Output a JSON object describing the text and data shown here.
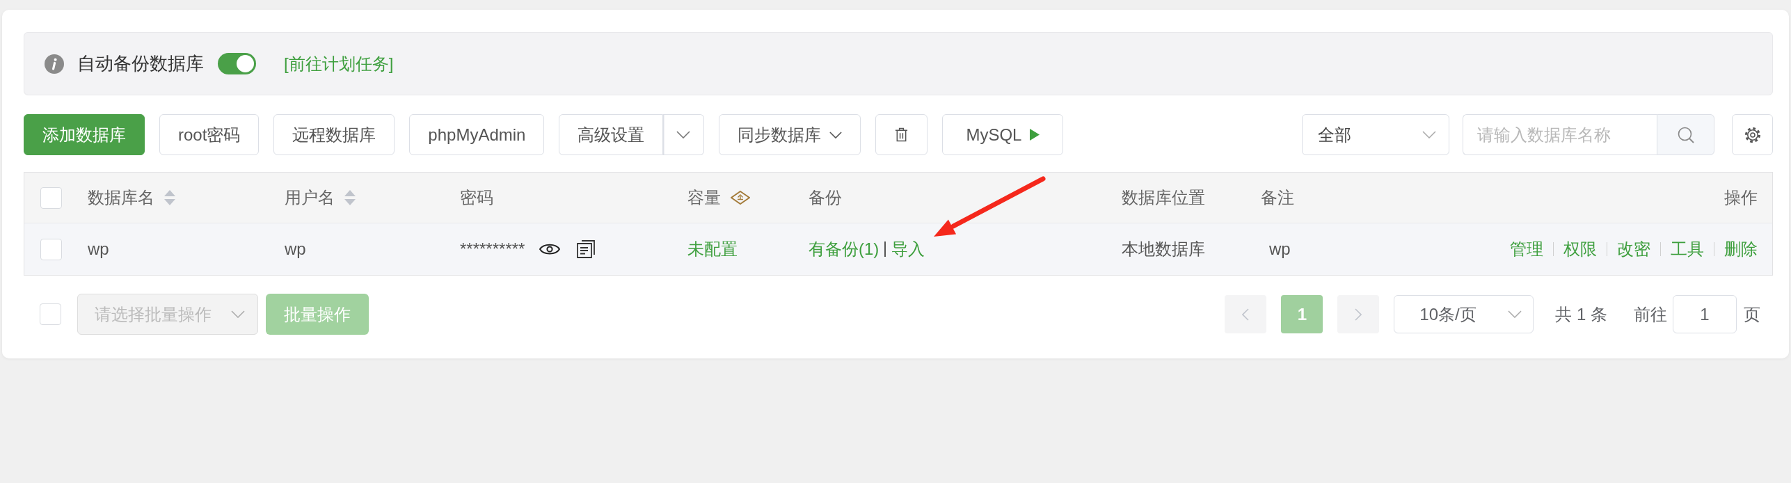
{
  "info_bar": {
    "label": "自动备份数据库",
    "toggle": {
      "on": true
    },
    "link": "[前往计划任务]"
  },
  "toolbar": {
    "buttons": [
      {
        "kind": "primary",
        "label": "添加数据库"
      },
      {
        "kind": "plain",
        "label": "root密码"
      },
      {
        "kind": "plain",
        "label": "远程数据库"
      },
      {
        "kind": "plain",
        "label": "phpMyAdmin"
      },
      {
        "kind": "split",
        "label": "高级设置"
      },
      {
        "kind": "dropdown",
        "label": "同步数据库"
      },
      {
        "kind": "trash"
      },
      {
        "kind": "run",
        "label": "MySQL"
      }
    ],
    "filter": {
      "value": "全部"
    },
    "search": {
      "placeholder": "请输入数据库名称"
    }
  },
  "table": {
    "select_all": {
      "checked": false
    },
    "columns": [
      {
        "label": "数据库名",
        "kind": "sortable"
      },
      {
        "label": "用户名",
        "kind": "sortable"
      },
      {
        "label": "密码",
        "kind": "plain"
      },
      {
        "label": "容量",
        "kind": "premium"
      },
      {
        "label": "备份",
        "kind": "plain"
      },
      {
        "label": "数据库位置",
        "kind": "plain"
      },
      {
        "label": "备注",
        "kind": "plain"
      },
      {
        "label": "操作",
        "kind": "plain"
      }
    ],
    "rows": [
      {
        "checked": false,
        "name": "wp",
        "user": "wp",
        "password": "**********",
        "capacity": "未配置",
        "backup": "有备份(1)",
        "backup_action": "导入",
        "location": "本地数据库",
        "note": "wp",
        "actions": [
          "管理",
          "权限",
          "改密",
          "工具",
          "删除"
        ]
      }
    ]
  },
  "footer": {
    "select_all": {
      "checked": false
    },
    "batch_select": {
      "placeholder": "请选择批量操作",
      "disabled": true
    },
    "batch_button": {
      "label": "批量操作",
      "disabled": true
    },
    "pagination": {
      "prev": {
        "disabled": true
      },
      "pages": [
        {
          "label": "1",
          "selected": true
        }
      ],
      "next": {
        "disabled": true
      },
      "page_size": "10条/页",
      "total": "共 1 条",
      "goto_label": "前往",
      "goto_value": "1",
      "suffix": "页"
    }
  }
}
